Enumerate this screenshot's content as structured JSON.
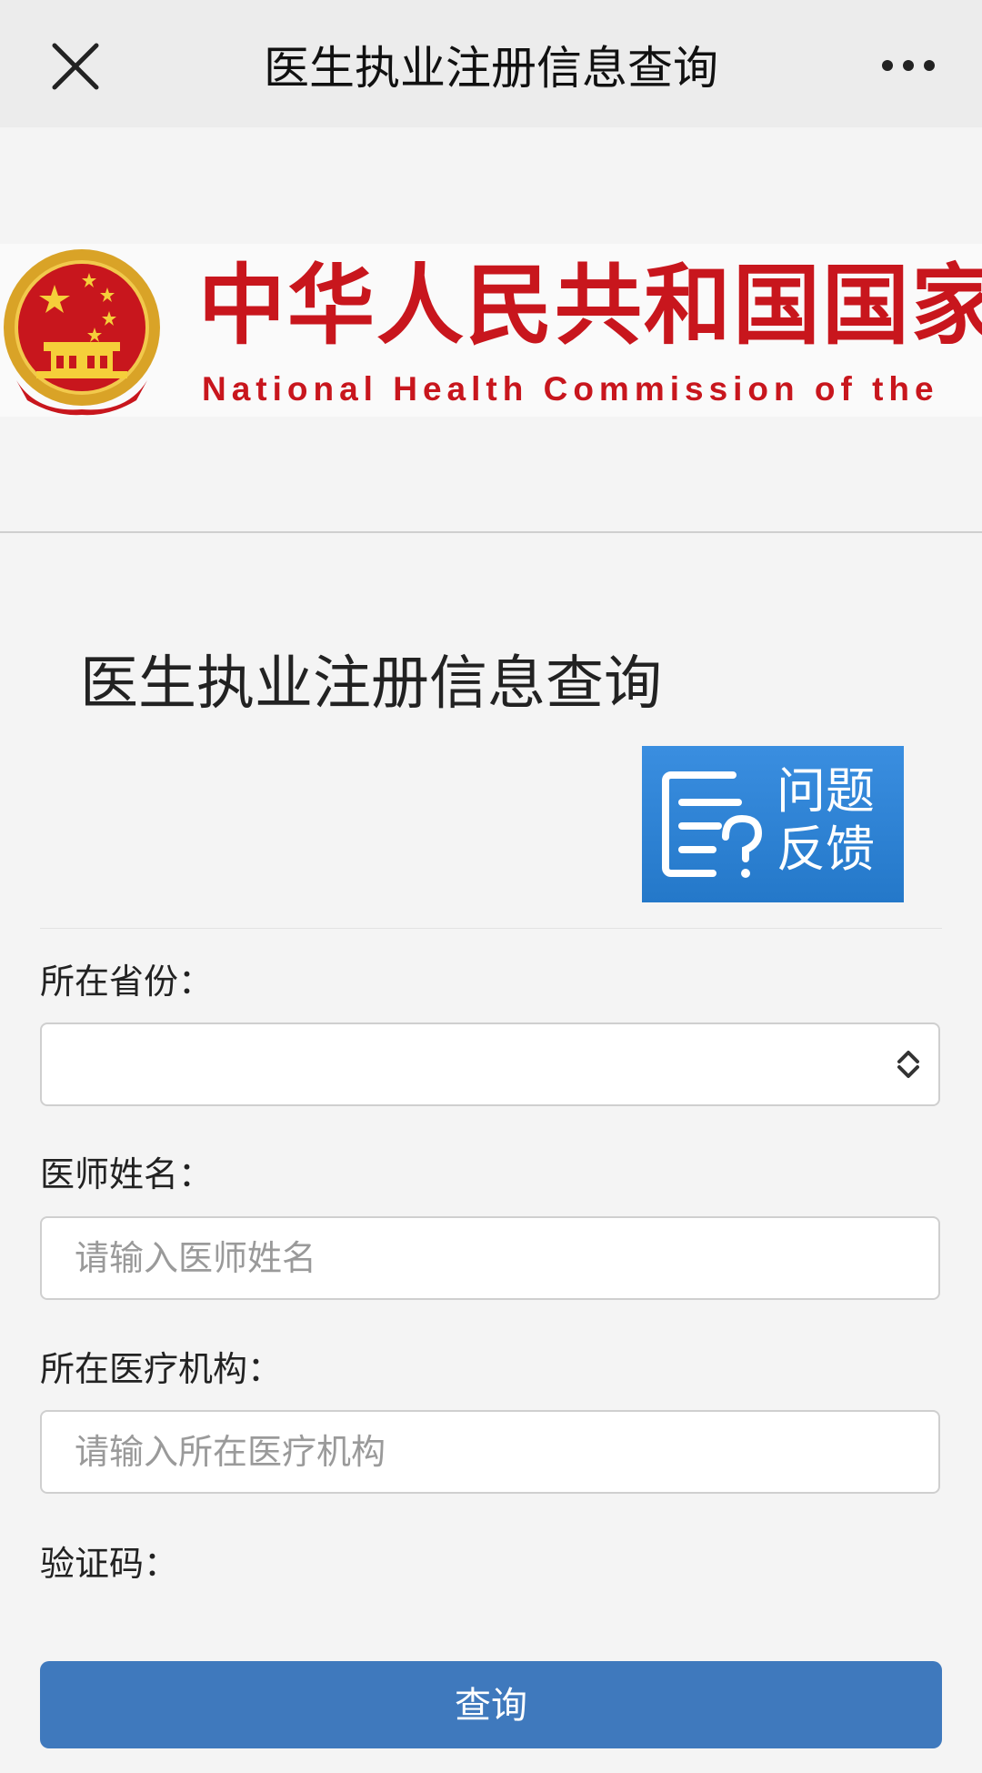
{
  "nav": {
    "title": "医生执业注册信息查询",
    "close_icon": "close-icon",
    "more_icon": "more-icon"
  },
  "banner": {
    "cn_text": "中华人民共和国国家",
    "en_text": "National Health Commission of the",
    "emblem_icon": "national-emblem-icon",
    "accent_color": "#c8161d"
  },
  "page": {
    "heading": "医生执业注册信息查询"
  },
  "feedback": {
    "line1": "问题",
    "line2": "反馈",
    "icon": "feedback-document-question-icon",
    "color": "#2f82d2"
  },
  "form": {
    "province_label": "所在省份：",
    "province_value": "",
    "name_label": "医师姓名：",
    "name_placeholder": "请输入医师姓名",
    "institution_label": "所在医疗机构：",
    "institution_placeholder": "请输入所在医疗机构",
    "captcha_label": "验证码：",
    "submit_label": "查询",
    "submit_color": "#3f79bd"
  }
}
